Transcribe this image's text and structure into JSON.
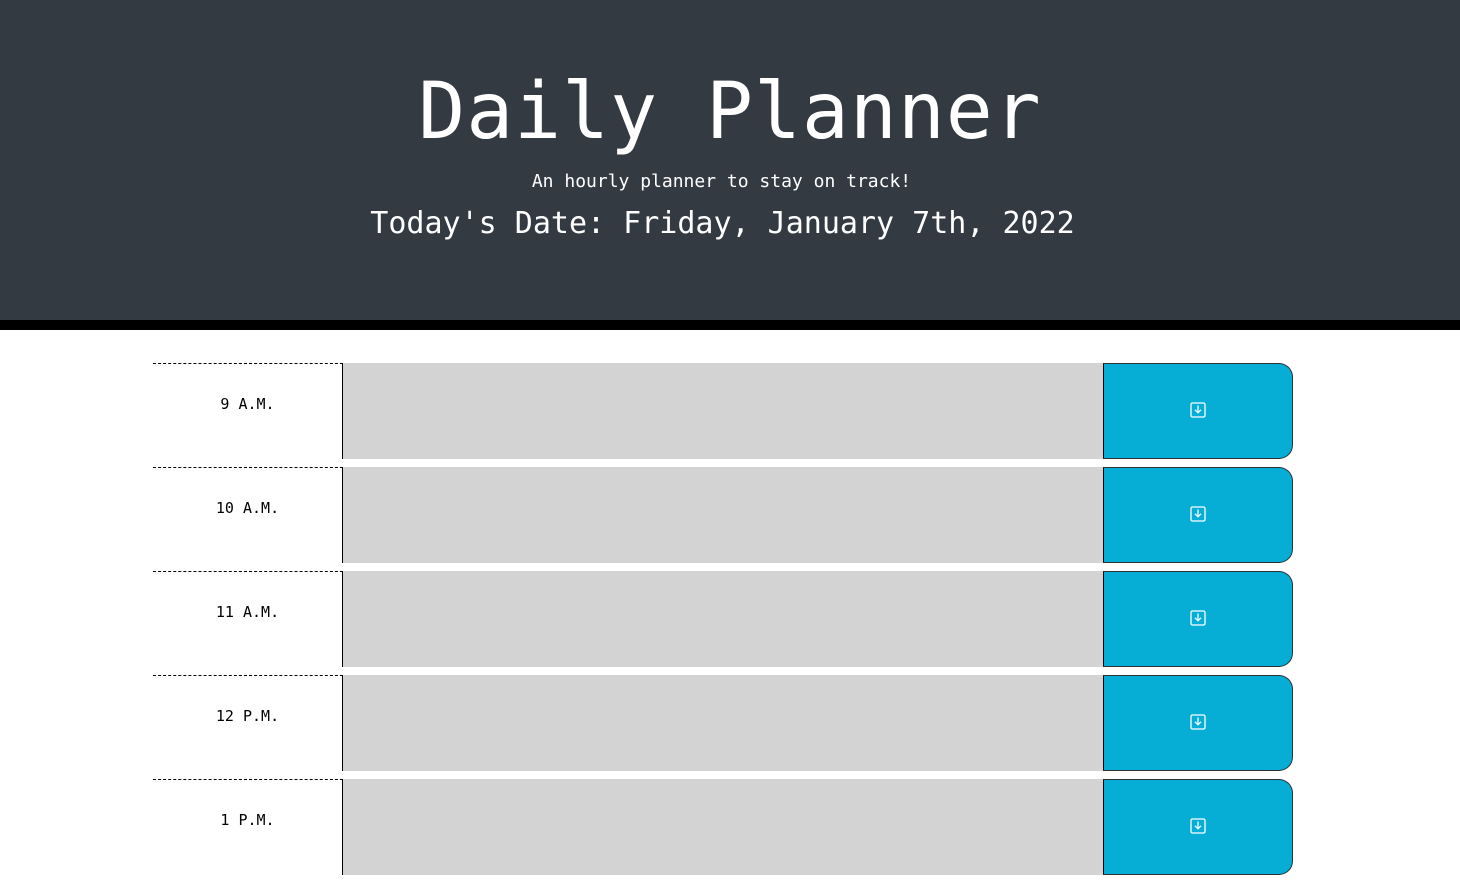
{
  "header": {
    "title": "Daily Planner",
    "subtitle": "An hourly planner to stay on track!",
    "date": "Today's Date: Friday, January 7th, 2022"
  },
  "colors": {
    "header_bg": "#343a42",
    "row_past": "#d3d3d3",
    "save_button": "#06aed5"
  },
  "rows": [
    {
      "hour": "9 A.M.",
      "text": "",
      "icon": "save-icon"
    },
    {
      "hour": "10 A.M.",
      "text": "",
      "icon": "save-icon"
    },
    {
      "hour": "11 A.M.",
      "text": "",
      "icon": "save-icon"
    },
    {
      "hour": "12 P.M.",
      "text": "",
      "icon": "save-icon"
    },
    {
      "hour": "1 P.M.",
      "text": "",
      "icon": "save-icon"
    }
  ]
}
